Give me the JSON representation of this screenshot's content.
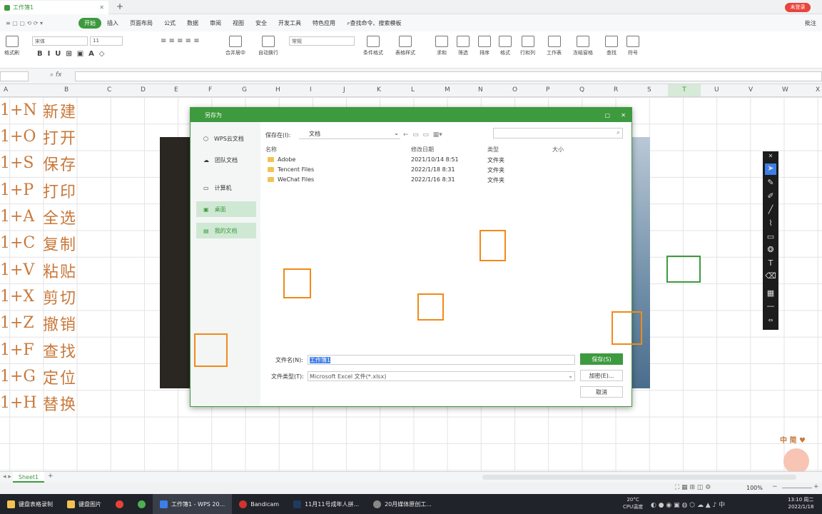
{
  "app": {
    "tab_title": "工作簿1",
    "unlogged": "未登录",
    "batch": "批注"
  },
  "menu": [
    "开始",
    "插入",
    "页面布局",
    "公式",
    "数据",
    "审阅",
    "视图",
    "安全",
    "开发工具",
    "特色应用"
  ],
  "search_cmd": "查找命令、搜索模板",
  "ribbon": {
    "font_name": "宋体",
    "font_size": "11",
    "number_format": "常规",
    "format_brush": "格式刷",
    "merge": "合并居中",
    "wrap": "自动换行",
    "cond_format": "条件格式",
    "table_style": "表格样式",
    "sum": "求和",
    "filter": "筛选",
    "sort": "排序",
    "format": "格式",
    "rowcol": "行和列",
    "sheet": "工作表",
    "freeze": "冻结窗格",
    "find": "查找",
    "symbol": "符号"
  },
  "fx": "fx",
  "columns": [
    "A",
    "B",
    "C",
    "D",
    "E",
    "F",
    "G",
    "H",
    "I",
    "J",
    "K",
    "L",
    "M",
    "N",
    "O",
    "P",
    "Q",
    "R",
    "S",
    "T",
    "U",
    "V",
    "W",
    "X"
  ],
  "shortcuts": [
    {
      "key": "1+N",
      "desc": "新建"
    },
    {
      "key": "1+O",
      "desc": "打开"
    },
    {
      "key": "1+S",
      "desc": "保存"
    },
    {
      "key": "1+P",
      "desc": "打印"
    },
    {
      "key": "1+A",
      "desc": "全选"
    },
    {
      "key": "1+C",
      "desc": "复制"
    },
    {
      "key": "1+V",
      "desc": "粘贴"
    },
    {
      "key": "1+X",
      "desc": "剪切"
    },
    {
      "key": "1+Z",
      "desc": "撤销"
    },
    {
      "key": "1+F",
      "desc": "查找"
    },
    {
      "key": "1+G",
      "desc": "定位"
    },
    {
      "key": "1+H",
      "desc": "替换"
    }
  ],
  "dialog": {
    "title": "另存为",
    "sidebar": [
      "WPS云文档",
      "团队文档",
      "计算机",
      "桌面",
      "我的文档"
    ],
    "save_in_label": "保存在(I):",
    "save_in_value": "文档",
    "headers": {
      "name": "名称",
      "date": "修改日期",
      "type": "类型",
      "size": "大小"
    },
    "files": [
      {
        "name": "Adobe",
        "date": "2021/10/14 8:51",
        "type": "文件夹"
      },
      {
        "name": "Tencent Files",
        "date": "2022/1/18 8:31",
        "type": "文件夹"
      },
      {
        "name": "WeChat Files",
        "date": "2022/1/16 8:31",
        "type": "文件夹"
      }
    ],
    "filename_label": "文件名(N):",
    "filename_value": "工作簿1",
    "filetype_label": "文件类型(T):",
    "filetype_value": "Microsoft Excel 文件(*.xlsx)",
    "save_btn": "保存(S)",
    "encrypt_btn": "加密(E)...",
    "cancel_btn": "取消"
  },
  "sheet_tab": "Sheet1",
  "zoom": "100%",
  "taskbar": [
    {
      "label": "键盘表格录制",
      "color": "#f2c351"
    },
    {
      "label": "键盘图片",
      "color": "#f2c351"
    },
    {
      "label": "",
      "color": "#e94235"
    },
    {
      "label": "",
      "color": "#4caf50"
    },
    {
      "label": "工作簿1 - WPS 20...",
      "color": "#3d7de8"
    },
    {
      "label": "Bandicam",
      "color": "#d0342c"
    },
    {
      "label": "11月11号成年人拼...",
      "color": "#1e3a5f"
    },
    {
      "label": "20月媒体原创工...",
      "color": "#888888"
    }
  ],
  "weather": {
    "temp": "20°C",
    "cpu": "CPU温度"
  },
  "clock": {
    "time": "13:10 周二",
    "date": "2022/1/18"
  }
}
